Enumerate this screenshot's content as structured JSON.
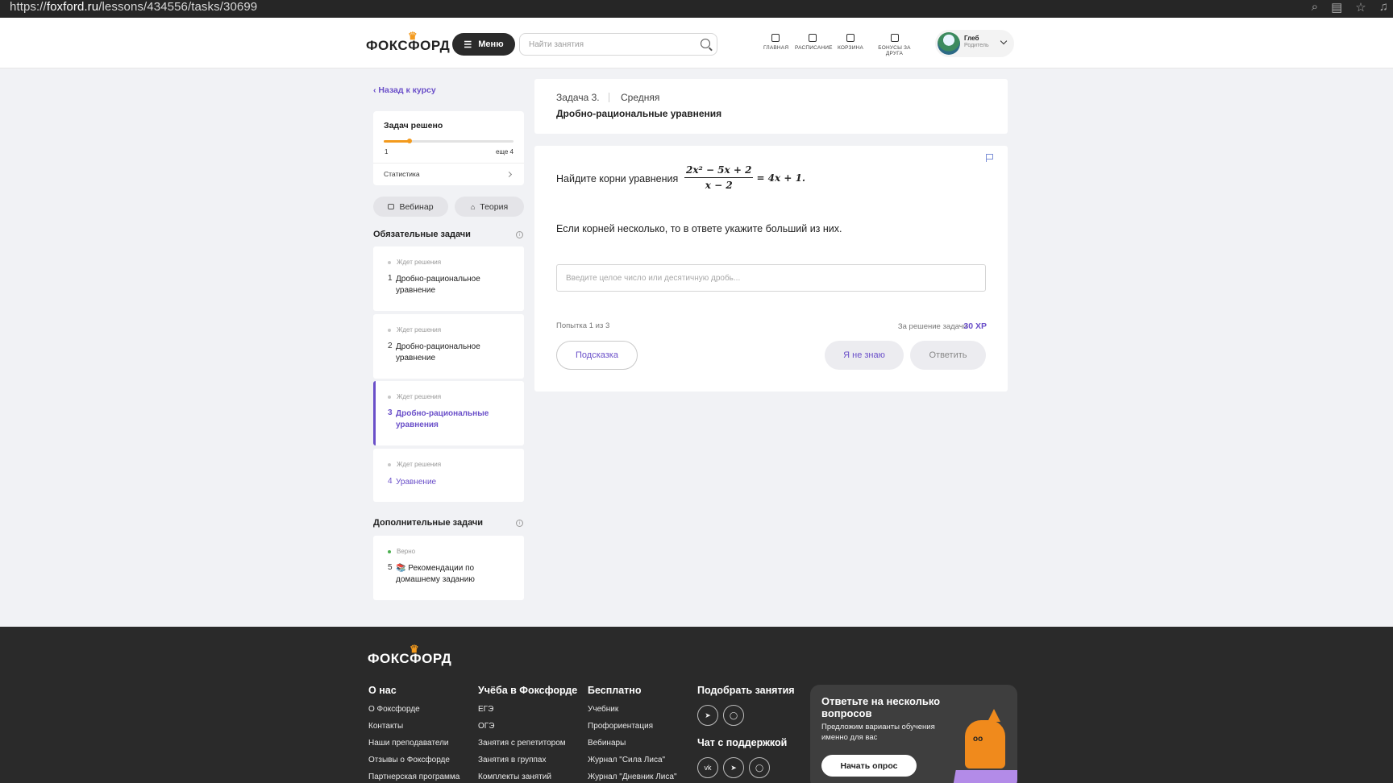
{
  "browser": {
    "url_prefix": "https://",
    "url_host": "foxford.ru",
    "url_path": "/lessons/434556/tasks/30699"
  },
  "header": {
    "logo": "ФОКСФОРД",
    "menu_label": "Меню",
    "search_placeholder": "Найти занятия",
    "nav": [
      {
        "label": "ГЛАВНАЯ",
        "icon": "home-icon"
      },
      {
        "label": "РАСПИСАНИЕ",
        "icon": "calendar-icon"
      },
      {
        "label": "КОРЗИНА",
        "icon": "cart-icon"
      },
      {
        "label": "БОНУСЫ ЗА ДРУГА",
        "icon": "gift-icon"
      }
    ],
    "user": {
      "name": "Глеб",
      "role": "Родитель"
    }
  },
  "sidebar": {
    "back_label": "Назад к курсу",
    "progress": {
      "title": "Задач решено",
      "solved": "1",
      "remaining": "еще 4",
      "fraction": 0.2
    },
    "stats_label": "Статистика",
    "webinar_label": "Вебинар",
    "theory_label": "Теория",
    "required_title": "Обязательные задачи",
    "required_tasks": [
      {
        "status": "Ждет решения",
        "num": "1",
        "title": "Дробно-рациональное уравнение"
      },
      {
        "status": "Ждет решения",
        "num": "2",
        "title": "Дробно-рациональное уравнение"
      },
      {
        "status": "Ждет решения",
        "num": "3",
        "title": "Дробно-рациональные уравнения"
      },
      {
        "status": "Ждет решения",
        "num": "4",
        "title": "Уравнение"
      }
    ],
    "extra_title": "Дополнительные задачи",
    "extra_tasks": [
      {
        "status": "Верно",
        "num": "5",
        "title": "📚 Рекомендации по домашнему заданию"
      }
    ]
  },
  "task": {
    "label": "Задача 3.",
    "level": "Средняя",
    "name": "Дробно-рациональные уравнения",
    "question": "Найдите корни уравнения",
    "formula_num": "2x² − 5x + 2",
    "formula_den": "x − 2",
    "formula_rhs": "= 4x + 1.",
    "instruction": "Если корней несколько, то в ответе укажите больший из них.",
    "answer_placeholder": "Введите целое число или десятичную дробь...",
    "attempts": "Попытка 1 из 3",
    "reward_label": "За решение задачи",
    "reward_xp": "30 XP",
    "hint_label": "Подсказка",
    "dont_know_label": "Я не знаю",
    "answer_label": "Ответить"
  },
  "footer": {
    "logo": "ФОКСФОРД",
    "col_about": {
      "title": "О нас",
      "links": [
        "О Фоксфорде",
        "Контакты",
        "Наши преподаватели",
        "Отзывы о Фоксфорде",
        "Партнерская программа"
      ]
    },
    "col_study": {
      "title": "Учёба в Фоксфорде",
      "links": [
        "ЕГЭ",
        "ОГЭ",
        "Занятия с репетитором",
        "Занятия в группах",
        "Комплекты занятий"
      ]
    },
    "col_free": {
      "title": "Бесплатно",
      "links": [
        "Учебник",
        "Профориентация",
        "Вебинары",
        "Журнал \"Сила Лиса\"",
        "Журнал \"Дневник Лиса\""
      ]
    },
    "pick_title": "Подобрать занятия",
    "chat_title": "Чат с поддержкой",
    "survey": {
      "title": "Ответьте на несколько вопросов",
      "subtitle": "Предложим варианты обучения именно для вас",
      "button": "Начать опрос"
    }
  }
}
